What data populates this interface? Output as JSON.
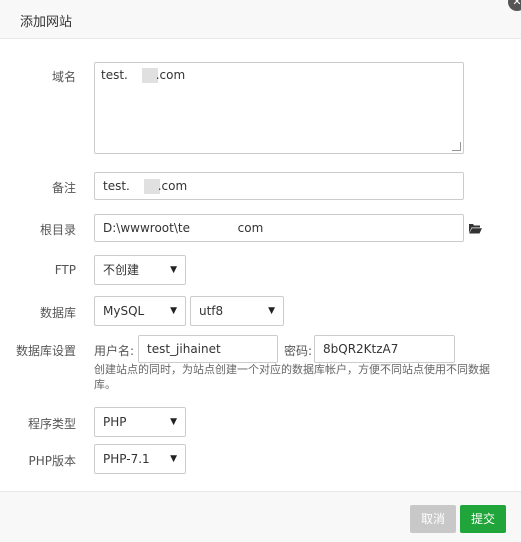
{
  "dialog": {
    "title": "添加网站"
  },
  "form": {
    "domain": {
      "label": "域名",
      "value_prefix": "test.",
      "value_suffix": ".com"
    },
    "remark": {
      "label": "备注",
      "value_prefix": "test.",
      "value_suffix": ".com"
    },
    "root": {
      "label": "根目录",
      "value_prefix": "D:\\wwwroot\\te",
      "value_suffix": "com"
    },
    "ftp": {
      "label": "FTP",
      "selected": "不创建"
    },
    "database": {
      "label": "数据库",
      "type_selected": "MySQL",
      "charset_selected": "utf8"
    },
    "db_settings": {
      "label": "数据库设置",
      "user_label": "用户名:",
      "user_value": "test_jihainet",
      "password_label": "密码:",
      "password_value": "8bQR2KtzA7",
      "hint": "创建站点的同时，为站点创建一个对应的数据库帐户，方便不同站点使用不同数据库。"
    },
    "program_type": {
      "label": "程序类型",
      "selected": "PHP"
    },
    "php_version": {
      "label": "PHP版本",
      "selected": "PHP-7.1"
    }
  },
  "footer": {
    "cancel_label": "取消",
    "submit_label": "提交"
  },
  "icons": {
    "close": "close-icon",
    "folder": "folder-open-icon",
    "caret": "caret-down-icon"
  },
  "colors": {
    "submit": "#20a53a",
    "cancel": "#c8c8c8"
  }
}
